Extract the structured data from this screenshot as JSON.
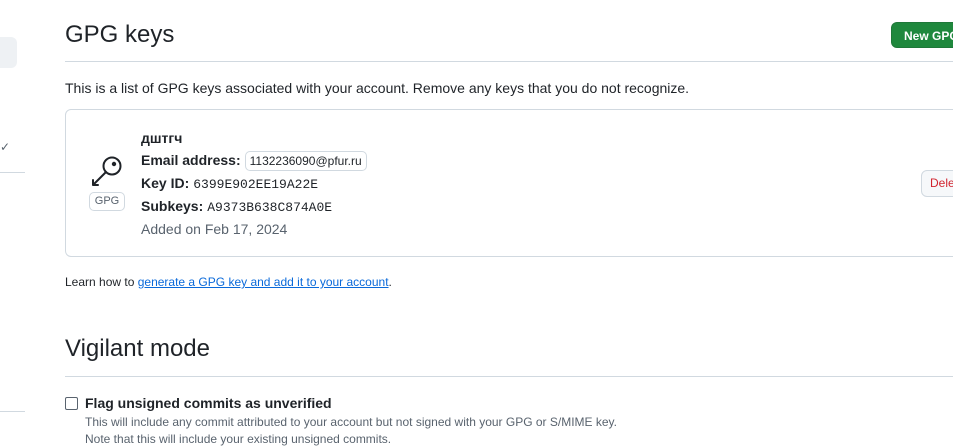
{
  "gpg_section": {
    "title": "GPG keys",
    "new_button": "New GPG key",
    "description": "This is a list of GPG keys associated with your account. Remove any keys that you do not recognize.",
    "keys": [
      {
        "name": "дштгч",
        "badge": "GPG",
        "email_label": "Email address:",
        "email": "1132236090@pfur.ru",
        "key_id_label": "Key ID:",
        "key_id": "6399E902EE19A22E",
        "subkeys_label": "Subkeys:",
        "subkeys": "A9373B638C874A0E",
        "added": "Added on Feb 17, 2024",
        "delete_button": "Delete"
      }
    ],
    "learn_prefix": "Learn how to ",
    "learn_link": "generate a GPG key and add it to your account",
    "learn_suffix": "."
  },
  "vigilant_section": {
    "title": "Vigilant mode",
    "checkbox_label": "Flag unsigned commits as unverified",
    "checkbox_checked": false,
    "note_line1": "This will include any commit attributed to your account but not signed with your GPG or S/MIME key.",
    "note_line2": "Note that this will include your existing unsigned commits."
  },
  "icons": {
    "key": "key-icon",
    "sidebar_check": "check-icon"
  },
  "colors": {
    "primary_button": "#1f883d",
    "danger": "#d1242f",
    "link": "#0969da",
    "border": "#d1d9e0"
  }
}
